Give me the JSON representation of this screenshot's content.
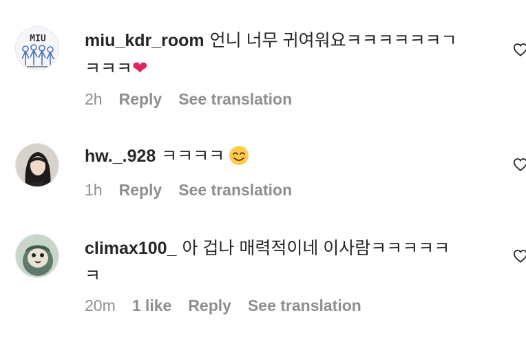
{
  "comments": [
    {
      "username": "miu_kdr_room",
      "text_line1": "언니 너무 귀여워요ㅋㅋㅋㅋㅋㅋㄱ",
      "text_line2": "ㅋㅋㅋ",
      "emoji": "heart-emoji",
      "avatar_label": "MIU",
      "time": "2h",
      "reply_label": "Reply",
      "translate_label": "See translation"
    },
    {
      "username": "hw._.928",
      "text_line1": "ㅋㅋㅋㅋ",
      "emoji": "smiling-face-emoji",
      "time": "1h",
      "reply_label": "Reply",
      "translate_label": "See translation"
    },
    {
      "username": "climax100_",
      "text_line1": "아 겁나 매력적이네 이사람ㅋㅋㅋㅋㅋ",
      "text_line2": "ㅋ",
      "time": "20m",
      "likes_label": "1 like",
      "reply_label": "Reply",
      "translate_label": "See translation"
    }
  ],
  "colors": {
    "text": "#262626",
    "secondary": "#8e8e8e",
    "heart": "#e0245e"
  }
}
